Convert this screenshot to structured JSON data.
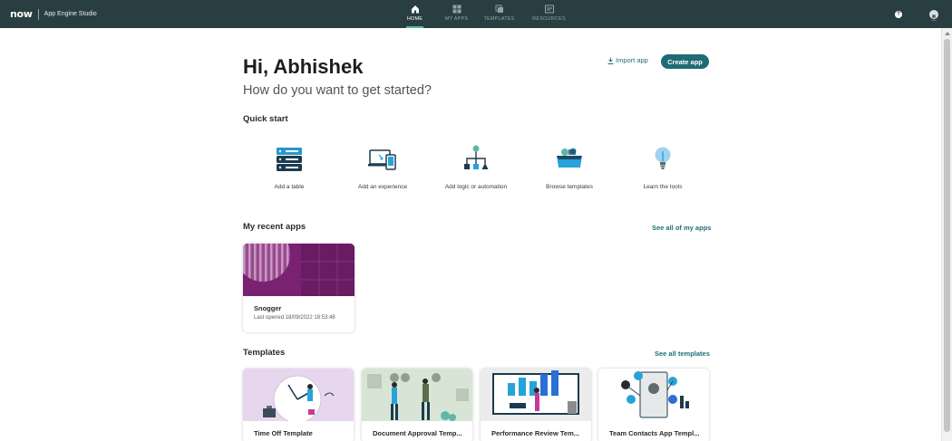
{
  "topbar": {
    "logo": "now",
    "app_name": "App Engine Studio",
    "nav": [
      {
        "label": "HOME",
        "icon": "home-icon",
        "active": true
      },
      {
        "label": "MY APPS",
        "icon": "apps-grid-icon",
        "active": false
      },
      {
        "label": "TEMPLATES",
        "icon": "templates-icon",
        "active": false
      },
      {
        "label": "RESOURCES",
        "icon": "resources-icon",
        "active": false
      }
    ],
    "help_icon": "help-icon",
    "user_icon": "user-avatar-icon"
  },
  "header": {
    "greeting": "Hi, Abhishek",
    "subtitle": "How do you want to get started?",
    "import_label": "Import app",
    "create_label": "Create app"
  },
  "quick_start": {
    "title": "Quick start",
    "items": [
      {
        "label": "Add a table",
        "icon": "database-icon"
      },
      {
        "label": "Add an experience",
        "icon": "devices-icon"
      },
      {
        "label": "Add logic or automation",
        "icon": "flow-icon"
      },
      {
        "label": "Browse templates",
        "icon": "templates-box-icon"
      },
      {
        "label": "Learn the tools",
        "icon": "lightbulb-icon"
      }
    ]
  },
  "recent_apps": {
    "title": "My recent apps",
    "see_all": "See all of my apps",
    "apps": [
      {
        "name": "Snogger",
        "meta": "Last opened 18/09/2022 18:53:48"
      }
    ]
  },
  "templates": {
    "title": "Templates",
    "see_all": "See all templates",
    "items": [
      {
        "name": "Time Off Template"
      },
      {
        "name": "Document Approval Temp..."
      },
      {
        "name": "Performance Review Tem..."
      },
      {
        "name": "Team Contacts App Templ..."
      }
    ]
  },
  "colors": {
    "topbar": "#293e40",
    "accent": "#1f6b76",
    "link": "#1d6f7a",
    "app_banner": "#7a2272"
  }
}
